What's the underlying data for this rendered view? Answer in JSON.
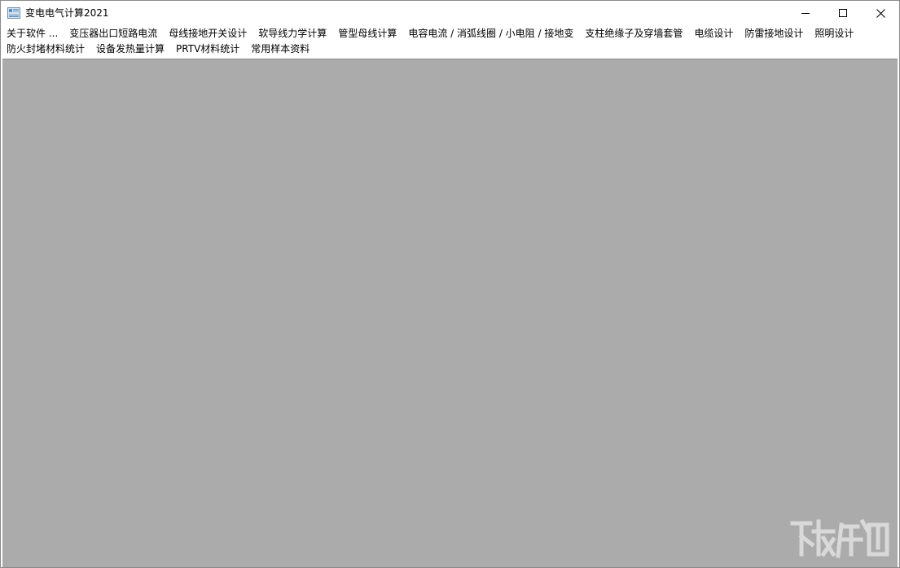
{
  "window": {
    "title": "变电电气计算2021"
  },
  "menu": {
    "row1": [
      "关于软件 ...",
      "变压器出口短路电流",
      "母线接地开关设计",
      "软导线力学计算",
      "管型母线计算",
      "电容电流 / 消弧线圈 / 小电阻 / 接地变",
      "支柱绝缘子及穿墙套管",
      "电缆设计",
      "防雷接地设计",
      "照明设计"
    ],
    "row2": [
      "防火封堵材料统计",
      "设备发热量计算",
      "PRTV材料统计",
      "常用样本资料"
    ]
  },
  "icons": {
    "app": "app-icon",
    "minimize": "minimize-icon",
    "maximize": "maximize-icon",
    "close": "close-icon"
  },
  "colors": {
    "client_background": "#ababab",
    "titlebar": "#ffffff"
  }
}
